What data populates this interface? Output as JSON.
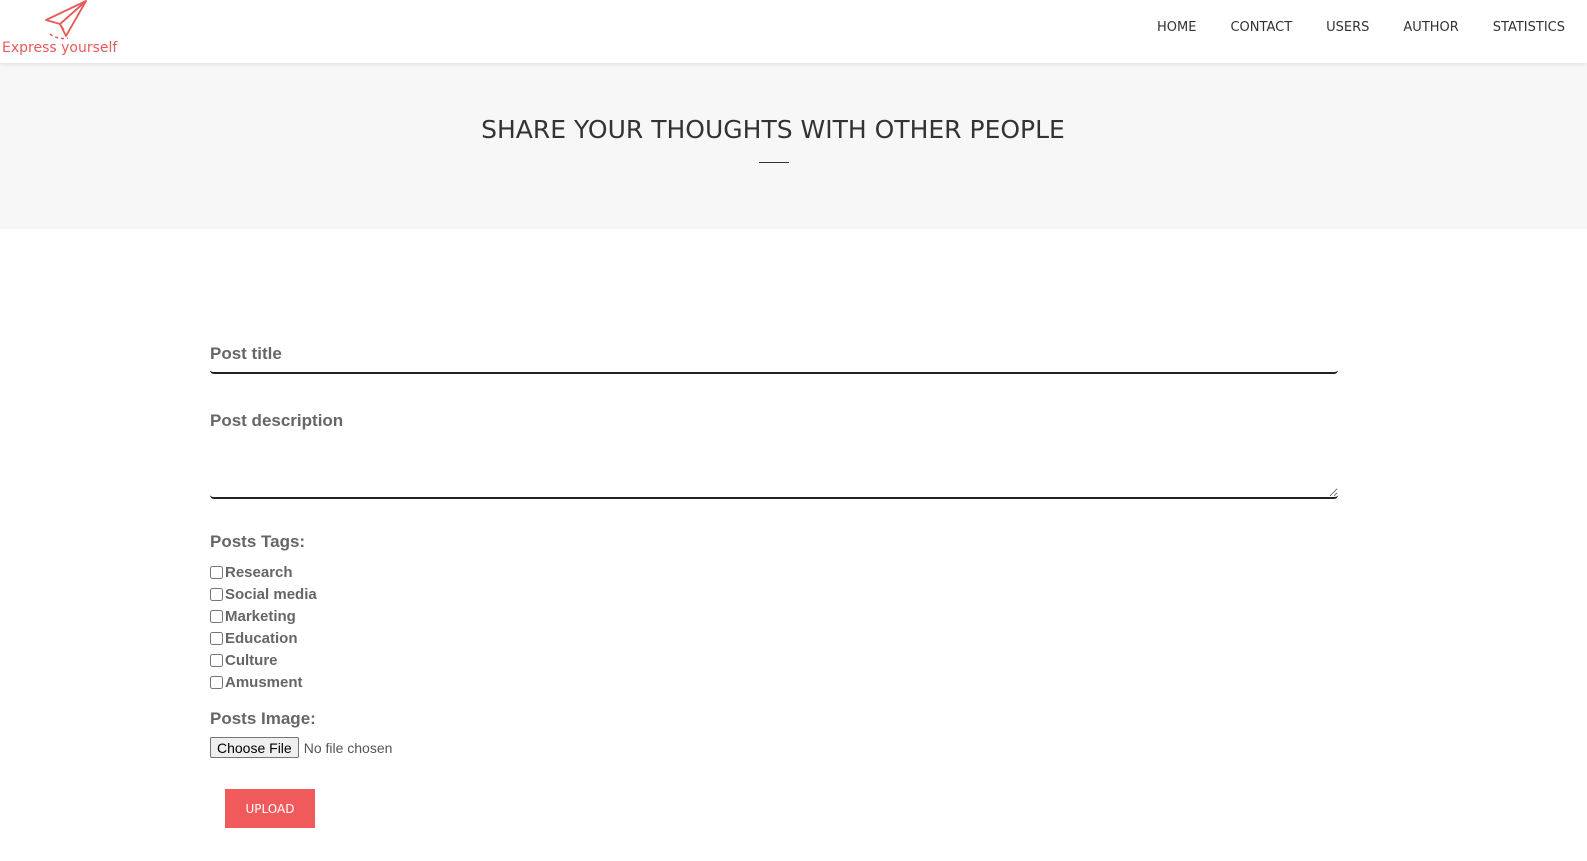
{
  "logo": {
    "text": "Express yourself",
    "color": "#e85a5a"
  },
  "nav": {
    "items": [
      {
        "label": "HOME"
      },
      {
        "label": "CONTACT"
      },
      {
        "label": "USERS"
      },
      {
        "label": "AUTHOR"
      },
      {
        "label": "STATISTICS"
      }
    ]
  },
  "hero": {
    "title": "SHARE YOUR THOUGHTS WITH OTHER PEOPLE"
  },
  "form": {
    "title_placeholder": "Post title",
    "description_placeholder": "Post description",
    "tags_label": "Posts Tags:",
    "tags": [
      {
        "label": "Research",
        "checked": false
      },
      {
        "label": "Social media",
        "checked": false
      },
      {
        "label": "Marketing",
        "checked": false
      },
      {
        "label": "Education",
        "checked": false
      },
      {
        "label": "Culture",
        "checked": false
      },
      {
        "label": "Amusment",
        "checked": false
      }
    ],
    "image_label": "Posts Image:",
    "choose_file_label": "Choose File",
    "file_status": "No file chosen",
    "upload_label": "UPLOAD"
  },
  "colors": {
    "accent": "#f05a5a",
    "hero_bg": "#f7f7f7"
  }
}
